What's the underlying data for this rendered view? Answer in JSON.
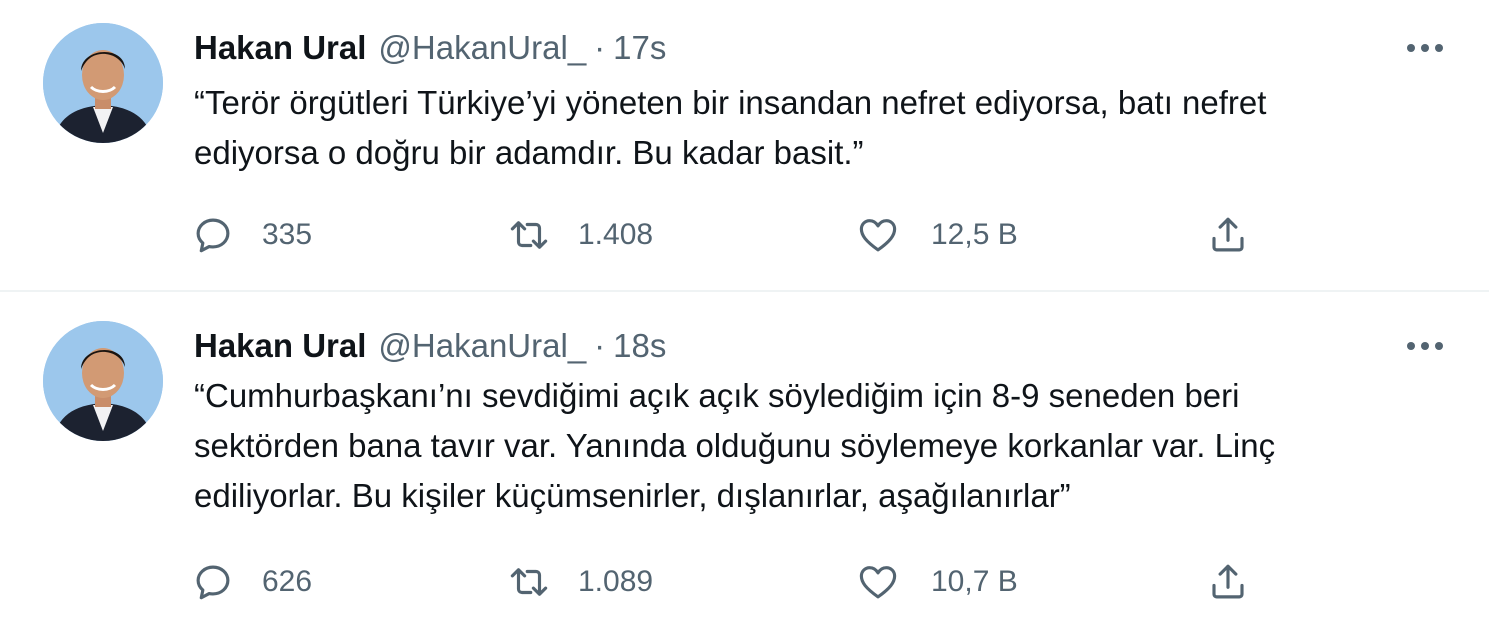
{
  "tweets": [
    {
      "author_name": "Hakan Ural",
      "handle": "@HakanUral_",
      "separator": "·",
      "time": "17s",
      "text": "“Terör örgütleri Türkiye’yi yöneten bir insandan nefret ediyorsa, batı nefret\nediyorsa o doğru bir adamdır. Bu kadar basit.”",
      "replies": "335",
      "retweets": "1.408",
      "likes": "12,5 B",
      "icons": {
        "reply": "reply-bubble-icon",
        "retweet": "retweet-icon",
        "like": "heart-icon",
        "share": "share-icon",
        "more": "more-horizontal-icon"
      }
    },
    {
      "author_name": "Hakan Ural",
      "handle": "@HakanUral_",
      "separator": "·",
      "time": "18s",
      "text": "“Cumhurbaşkanı’nı sevdiğimi açık açık söylediğim için 8-9 seneden beri\nsektörden bana tavır var. Yanında olduğunu söylemeye korkanlar var. Linç\nediliyorlar. Bu kişiler küçümsenirler, dışlanırlar, aşağılanırlar”",
      "replies": "626",
      "retweets": "1.089",
      "likes": "10,7 B",
      "icons": {
        "reply": "reply-bubble-icon",
        "retweet": "retweet-icon",
        "like": "heart-icon",
        "share": "share-icon",
        "more": "more-horizontal-icon"
      }
    }
  ],
  "colors": {
    "text_primary": "#0f1419",
    "text_secondary": "#536471",
    "divider": "#eff3f4",
    "avatar_background": "#9cc7ec"
  }
}
